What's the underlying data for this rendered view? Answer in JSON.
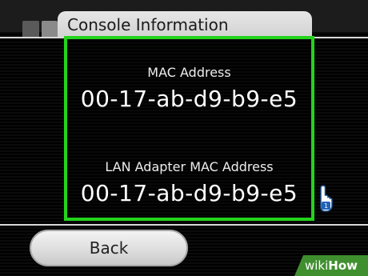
{
  "header": {
    "title": "Console Information"
  },
  "info": {
    "mac_label": "MAC Address",
    "mac_value": "00-17-ab-d9-b9-e5",
    "lan_label": "LAN Adapter MAC Address",
    "lan_value": "00-17-ab-d9-b9-e5"
  },
  "footer": {
    "back_label": "Back"
  },
  "cursor": {
    "player_number": "1"
  },
  "watermark": {
    "brand_part1": "wiki",
    "brand_part2": "How"
  },
  "colors": {
    "panel_border": "#23d41c",
    "background": "#000000",
    "title_tab": "#e0e0e0",
    "watermark": "#3f8f2f"
  },
  "icons": {
    "cursor": "pointing-hand-icon"
  }
}
